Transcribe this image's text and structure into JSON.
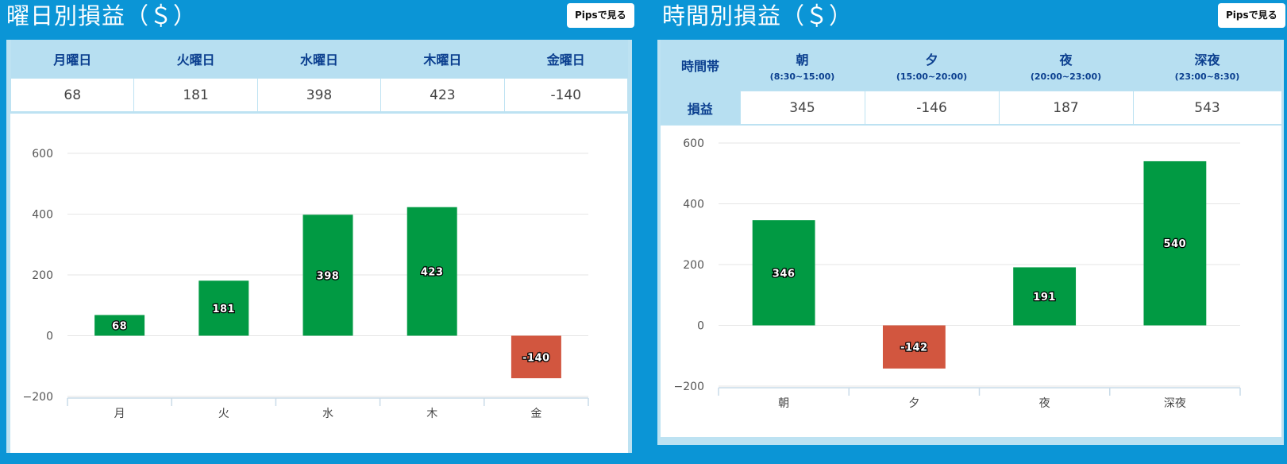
{
  "colors": {
    "background": "#0b95d6",
    "positive": "#019a43",
    "negative": "#d2563f",
    "header_bg": "#b7dff1",
    "header_text": "#0b3f8f"
  },
  "left": {
    "title": "曜日別損益（＄）",
    "pips_label": "Pipsで見る",
    "headers": [
      "月曜日",
      "火曜日",
      "水曜日",
      "木曜日",
      "金曜日"
    ],
    "values": [
      "68",
      "181",
      "398",
      "423",
      "-140"
    ]
  },
  "right": {
    "title": "時間別損益（＄）",
    "pips_label": "Pipsで見る",
    "corner_header": "時間帯",
    "row_label": "損益",
    "headers": [
      {
        "name": "朝",
        "range": "(8:30~15:00)"
      },
      {
        "name": "夕",
        "range": "(15:00~20:00)"
      },
      {
        "name": "夜",
        "range": "(20:00~23:00)"
      },
      {
        "name": "深夜",
        "range": "(23:00~8:30)"
      }
    ],
    "values": [
      "345",
      "-146",
      "187",
      "543"
    ]
  },
  "chart_data": [
    {
      "type": "bar",
      "categories": [
        "月",
        "火",
        "水",
        "木",
        "金"
      ],
      "values": [
        68,
        181,
        398,
        423,
        -140
      ],
      "labels": [
        "68",
        "181",
        "398",
        "423",
        "-140"
      ],
      "ylim": [
        -200,
        600
      ],
      "yticks": [
        -200,
        0,
        200,
        400,
        600
      ],
      "ytick_labels": [
        "−200",
        "0",
        "200",
        "400",
        "600"
      ],
      "grid": true
    },
    {
      "type": "bar",
      "categories": [
        "朝",
        "夕",
        "夜",
        "深夜"
      ],
      "values": [
        346,
        -142,
        191,
        540
      ],
      "labels": [
        "346",
        "-142",
        "191",
        "540"
      ],
      "ylim": [
        -200,
        600
      ],
      "yticks": [
        -200,
        0,
        200,
        400,
        600
      ],
      "ytick_labels": [
        "−200",
        "0",
        "200",
        "400",
        "600"
      ],
      "grid": true
    }
  ]
}
